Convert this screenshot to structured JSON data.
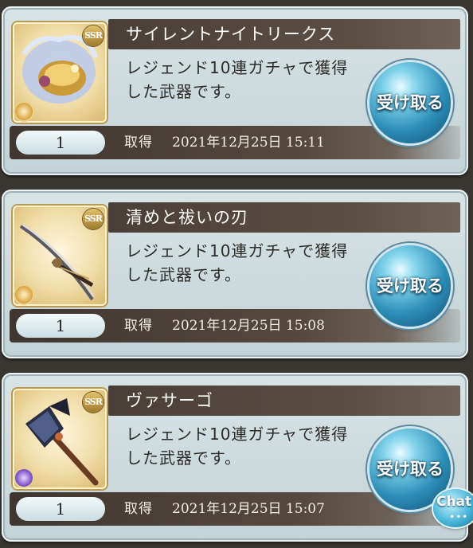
{
  "items": [
    {
      "name": "サイレントナイトリークス",
      "rarity": "SSR",
      "description": "レジェンド10連ガチャで獲得した武器です。",
      "quantity": "1",
      "acquired_label": "取得",
      "acquired_at": "2021年12月25日 15:11",
      "claim_label": "受け取る",
      "icon": "ornate-harp-weapon-icon",
      "element_icon": "light-element-icon",
      "element_color": "#d9a23c"
    },
    {
      "name": "清めと祓いの刃",
      "rarity": "SSR",
      "description": "レジェンド10連ガチャで獲得した武器です。",
      "quantity": "1",
      "acquired_label": "取得",
      "acquired_at": "2021年12月25日 15:08",
      "claim_label": "受け取る",
      "icon": "katana-weapon-icon",
      "element_icon": "light-element-icon",
      "element_color": "#d9a23c"
    },
    {
      "name": "ヴァサーゴ",
      "rarity": "SSR",
      "description": "レジェンド10連ガチャで獲得した武器です。",
      "quantity": "1",
      "acquired_label": "取得",
      "acquired_at": "2021年12月25日 15:07",
      "claim_label": "受け取る",
      "icon": "axe-weapon-icon",
      "element_icon": "dark-element-icon",
      "element_color": "#7b4fc6"
    }
  ],
  "chat_button": {
    "label": "Chat",
    "dots": "•••"
  }
}
